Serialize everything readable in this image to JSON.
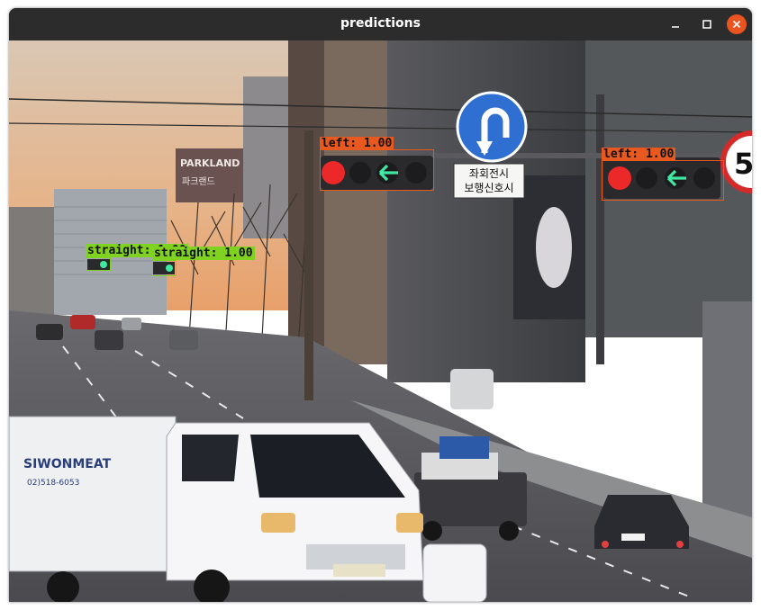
{
  "window": {
    "title": "predictions"
  },
  "colors": {
    "titlebar": "#2c2c2c",
    "close_button": "#e95420",
    "left_box": "#e8591f",
    "straight_box": "#7fd320",
    "sky_top": "#d9c7b4",
    "sky_bottom": "#e7a873"
  },
  "detections": [
    {
      "id": "det-left-1",
      "class": "left",
      "label": "left: 1.00"
    },
    {
      "id": "det-left-2",
      "class": "left",
      "label": "left: 1.00"
    },
    {
      "id": "det-straight-1",
      "class": "straight",
      "label": "straight: 1.00"
    },
    {
      "id": "det-straight-2",
      "class": "straight",
      "label": "straight: 1.00"
    }
  ],
  "scene_text": {
    "sign_korean_line1": "좌회전시",
    "sign_korean_line2": "보행신호시",
    "building_sign": "PARKLAND",
    "building_sign_korean": "파크랜드",
    "truck_brand": "SIWONMEAT",
    "truck_phone": "02)518-6053",
    "speed_sign": "5"
  },
  "icons": {
    "minimize": "minimize-icon",
    "maximize": "maximize-icon",
    "close": "close-icon",
    "u_turn": "u-turn-sign-icon"
  }
}
